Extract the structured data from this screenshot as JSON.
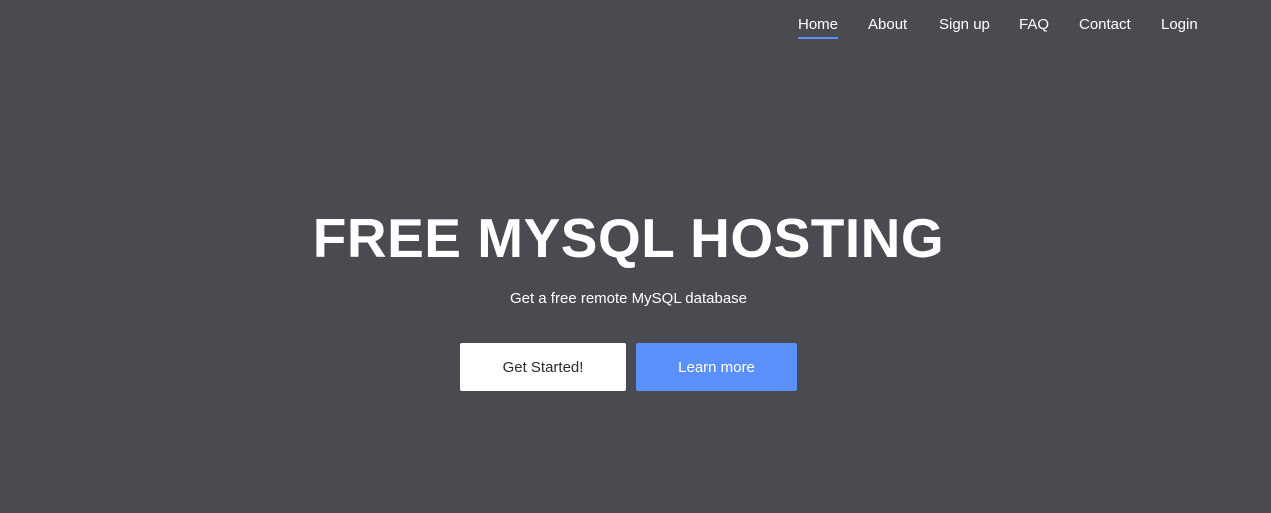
{
  "nav": {
    "items": [
      {
        "label": "Home",
        "active": true
      },
      {
        "label": "About"
      },
      {
        "label": "Sign up"
      },
      {
        "label": "FAQ"
      },
      {
        "label": "Contact"
      },
      {
        "label": "Login"
      }
    ]
  },
  "hero": {
    "title": "FREE MYSQL HOSTING",
    "subtitle": "Get a free remote MySQL database",
    "primary_button": "Get Started!",
    "secondary_button": "Learn more"
  },
  "colors": {
    "background": "#4a4b50",
    "accent": "#5b8ff9",
    "text": "#ffffff"
  }
}
